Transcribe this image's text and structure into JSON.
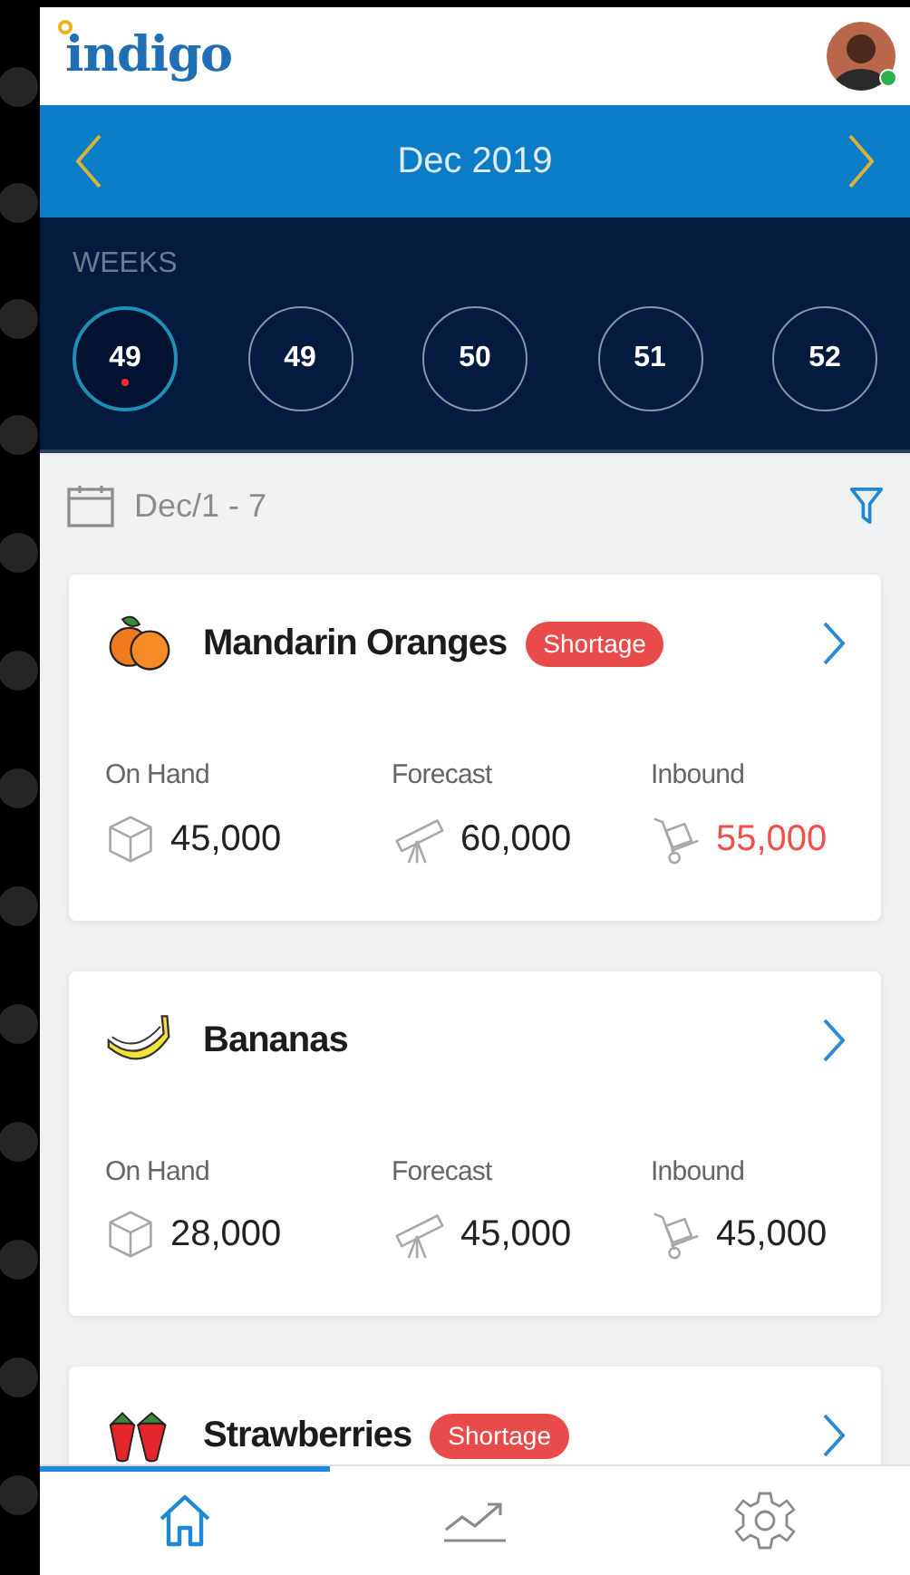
{
  "header": {
    "logo": "indigo",
    "avatar": {
      "online": true
    }
  },
  "month_bar": {
    "title": "Dec 2019"
  },
  "weeks": {
    "label": "WEEKS",
    "items": [
      {
        "label": "49",
        "selected": true,
        "alert": true
      },
      {
        "label": "49",
        "selected": false,
        "alert": false
      },
      {
        "label": "50",
        "selected": false,
        "alert": false
      },
      {
        "label": "51",
        "selected": false,
        "alert": false
      },
      {
        "label": "52",
        "selected": false,
        "alert": false
      }
    ]
  },
  "date_range": "Dec/1 - 7",
  "products": [
    {
      "name": "Mandarin Oranges",
      "kind": "orange",
      "badge": "Shortage",
      "stats": [
        {
          "kind": "box",
          "label": "On Hand",
          "value": "45,000",
          "alert": false
        },
        {
          "kind": "telescope",
          "label": "Forecast",
          "value": "60,000",
          "alert": false
        },
        {
          "kind": "cart",
          "label": "Inbound",
          "value": "55,000",
          "alert": true
        }
      ]
    },
    {
      "name": "Bananas",
      "kind": "banana",
      "stats": [
        {
          "kind": "box",
          "label": "On Hand",
          "value": "28,000",
          "alert": false
        },
        {
          "kind": "telescope",
          "label": "Forecast",
          "value": "45,000",
          "alert": false
        },
        {
          "kind": "cart",
          "label": "Inbound",
          "value": "45,000",
          "alert": false
        }
      ]
    },
    {
      "name": "Strawberries",
      "kind": "strawberry",
      "badge": "Shortage"
    }
  ],
  "bottom_nav": [
    {
      "kind": "home",
      "selected": true
    },
    {
      "kind": "chart",
      "selected": false
    },
    {
      "kind": "settings",
      "selected": false
    }
  ]
}
